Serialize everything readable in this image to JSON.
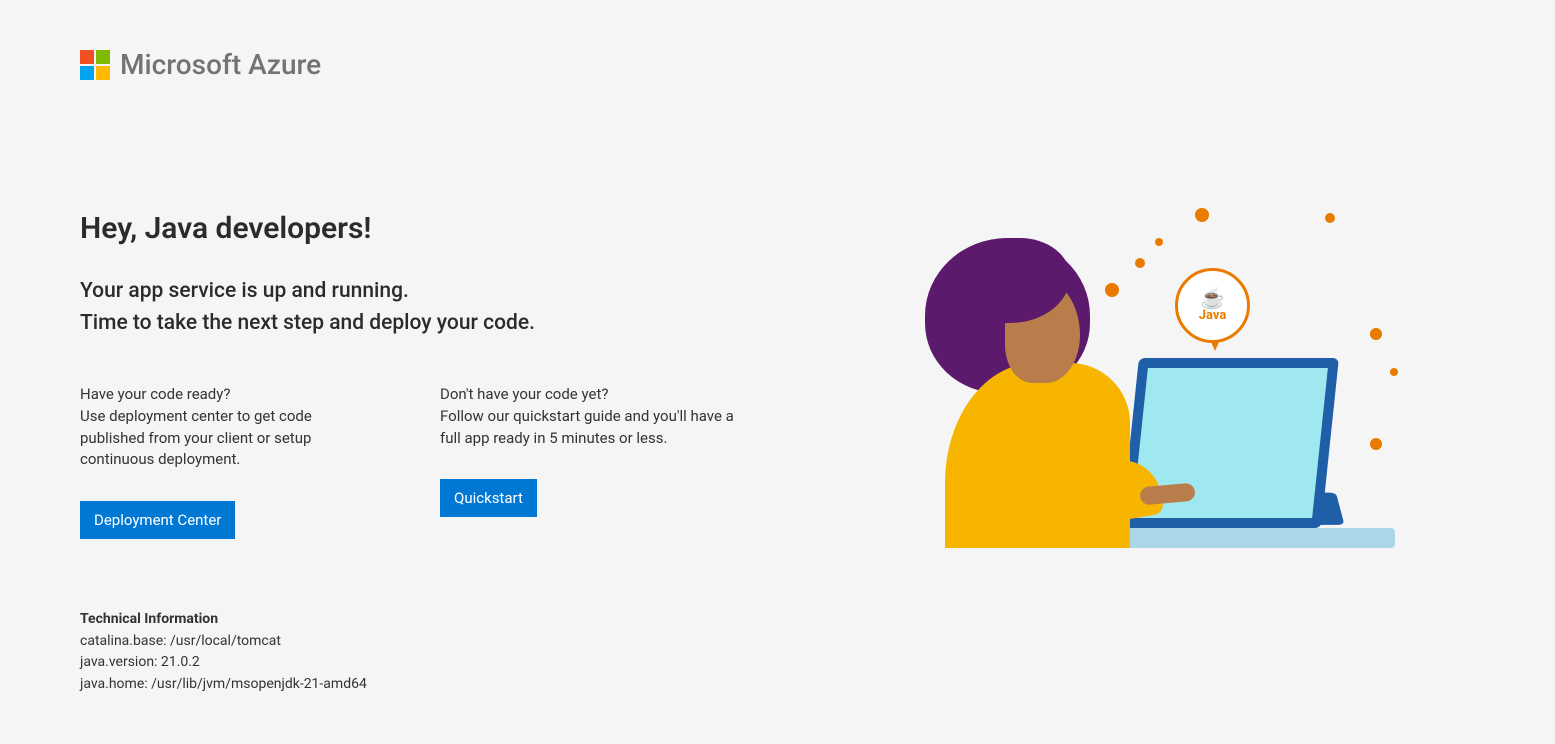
{
  "brand": "Microsoft Azure",
  "heading": "Hey, Java developers!",
  "subhead_line1": "Your app service is up and running.",
  "subhead_line2": "Time to take the next step and deploy your code.",
  "columns": {
    "left": {
      "q": "Have your code ready?",
      "desc": "Use deployment center to get code published from your client or setup continuous deployment.",
      "button": "Deployment Center"
    },
    "right": {
      "q": "Don't have your code yet?",
      "desc": "Follow our quickstart guide and you'll have a full app ready in 5 minutes or less.",
      "button": "Quickstart"
    }
  },
  "tech": {
    "title": "Technical Information",
    "lines": [
      "catalina.base: /usr/local/tomcat",
      "java.version: 21.0.2",
      "java.home: /usr/lib/jvm/msopenjdk-21-amd64"
    ]
  },
  "illustration": {
    "java_label": "Java"
  }
}
